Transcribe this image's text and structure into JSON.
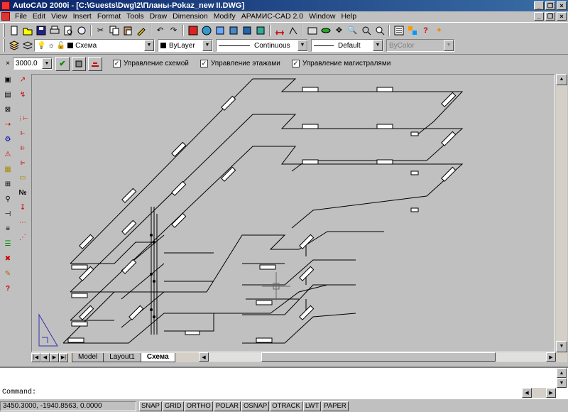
{
  "window": {
    "title": "AutoCAD 2000i - [C:\\Guests\\Dwg\\2\\Планы-Pokaz_new II.DWG]"
  },
  "menu": [
    "File",
    "Edit",
    "View",
    "Insert",
    "Format",
    "Tools",
    "Draw",
    "Dimension",
    "Modify",
    "АРАМИС-CAD 2.0",
    "Window",
    "Help"
  ],
  "toolbar2": {
    "layer": "Схема",
    "color": "ByLayer",
    "linetype": "Continuous",
    "lineweight": "Default",
    "plotstyle": "ByColor"
  },
  "toolbar3": {
    "value": "3000.0",
    "checks": [
      {
        "label": "Управление схемой",
        "checked": true
      },
      {
        "label": "Управление этажами",
        "checked": true
      },
      {
        "label": "Управление магистралями",
        "checked": true
      }
    ]
  },
  "tabs": [
    "Model",
    "Layout1",
    "Схема"
  ],
  "active_tab": "Схема",
  "command": {
    "prompt": "Command:"
  },
  "status": {
    "coords": "3450.3000, -1940.8563, 0.0000",
    "buttons": [
      "SNAP",
      "GRID",
      "ORTHO",
      "POLAR",
      "OSNAP",
      "OTRACK",
      "LWT",
      "PAPER"
    ]
  },
  "icons": {
    "minimize": "_",
    "restore": "❐",
    "close": "×"
  }
}
